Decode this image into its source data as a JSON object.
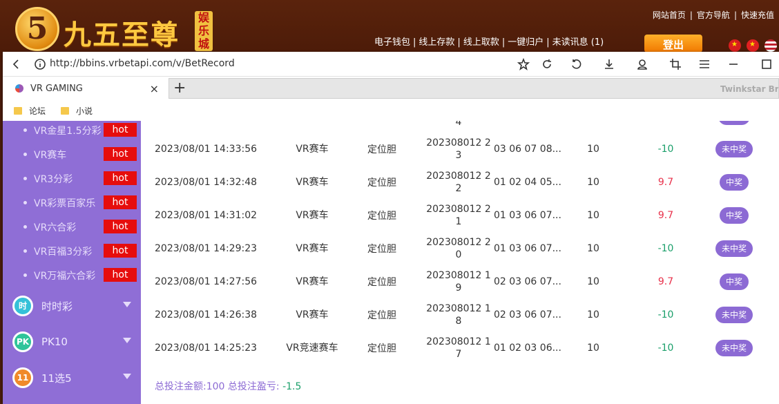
{
  "site": {
    "logo_mark": "5",
    "logo_text": "九五至尊",
    "logo_tag": "娱乐城",
    "top_links": [
      "网站首页",
      "|",
      "官方导航",
      "|",
      "快速充值"
    ],
    "sub_links": [
      "电子钱包",
      "|",
      "线上存款",
      "|",
      "线上取款",
      "|",
      "一键归户",
      "|",
      "未读讯息 (1)"
    ],
    "login_label": "登出"
  },
  "browser": {
    "url": "http://bbins.vrbetapi.com/v/BetRecord",
    "tab_title": "VR GAMING",
    "tab_close": "×",
    "new_tab": "+",
    "brand": "Twinkstar Bro",
    "bookmarks": [
      "论坛",
      "小说"
    ]
  },
  "sidebar": {
    "sub_items": [
      {
        "label": "VR金星1.5分彩",
        "badge": "hot"
      },
      {
        "label": "VR赛车",
        "badge": "hot"
      },
      {
        "label": "VR3分彩",
        "badge": "hot"
      },
      {
        "label": "VR彩票百家乐",
        "badge": "hot"
      },
      {
        "label": "VR六合彩",
        "badge": "hot"
      },
      {
        "label": "VR百福3分彩",
        "badge": "hot"
      },
      {
        "label": "VR万福六合彩",
        "badge": "hot"
      }
    ],
    "categories": [
      {
        "label": "时时彩",
        "icon_text": "时",
        "color": "#35c1d8"
      },
      {
        "label": "PK10",
        "icon_text": "PK",
        "color": "#2fc49a"
      },
      {
        "label": "11选5",
        "icon_text": "11",
        "color": "#f08a2a"
      }
    ]
  },
  "records": {
    "top_partial_issue": "4",
    "rows": [
      {
        "time": "2023/08/01 14:33:56",
        "game": "VR赛车",
        "type": "定位胆",
        "issue": "202308012 23",
        "numbers": "03 06 07 08...",
        "bet": "10",
        "pl": "-10",
        "status": "未中奖"
      },
      {
        "time": "2023/08/01 14:32:48",
        "game": "VR赛车",
        "type": "定位胆",
        "issue": "202308012 22",
        "numbers": "01 02 04 05...",
        "bet": "10",
        "pl": "9.7",
        "status": "中奖"
      },
      {
        "time": "2023/08/01 14:31:02",
        "game": "VR赛车",
        "type": "定位胆",
        "issue": "202308012 21",
        "numbers": "01 03 06 07...",
        "bet": "10",
        "pl": "9.7",
        "status": "中奖"
      },
      {
        "time": "2023/08/01 14:29:23",
        "game": "VR赛车",
        "type": "定位胆",
        "issue": "202308012 20",
        "numbers": "01 03 06 07...",
        "bet": "10",
        "pl": "-10",
        "status": "未中奖"
      },
      {
        "time": "2023/08/01 14:27:56",
        "game": "VR赛车",
        "type": "定位胆",
        "issue": "202308012 19",
        "numbers": "02 03 06 07...",
        "bet": "10",
        "pl": "9.7",
        "status": "中奖"
      },
      {
        "time": "2023/08/01 14:26:38",
        "game": "VR赛车",
        "type": "定位胆",
        "issue": "202308012 18",
        "numbers": "02 03 06 07...",
        "bet": "10",
        "pl": "-10",
        "status": "未中奖"
      },
      {
        "time": "2023/08/01 14:25:23",
        "game": "VR竞速赛车",
        "type": "定位胆",
        "issue": "202308012 17",
        "numbers": "01 02 03 06...",
        "bet": "10",
        "pl": "-10",
        "status": "未中奖"
      }
    ],
    "summary_prefix": "总投注金额:100 总投注盈亏: ",
    "summary_value": "-1.5"
  }
}
